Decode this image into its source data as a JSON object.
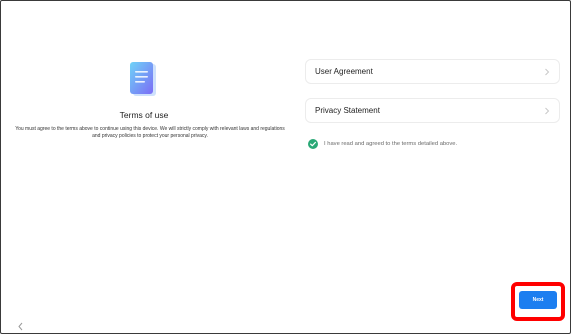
{
  "terms": {
    "title": "Terms of use",
    "description": "You must agree to the terms above to continue using this device. We will strictly comply with relevant laws and regulations and privacy policies to protect your personal privacy.",
    "icon": "document-icon"
  },
  "agreements": [
    {
      "label": "User Agreement",
      "icon": "chevron-right-icon"
    },
    {
      "label": "Privacy Statement",
      "icon": "chevron-right-icon"
    }
  ],
  "consent": {
    "text": "I have read and agreed to the terms detailed above.",
    "checked": true,
    "color": "#2aa876"
  },
  "navigation": {
    "next_label": "Next",
    "back_icon": "chevron-left-icon",
    "accent": "#1c7ef0",
    "highlight_color": "#ff0000"
  }
}
